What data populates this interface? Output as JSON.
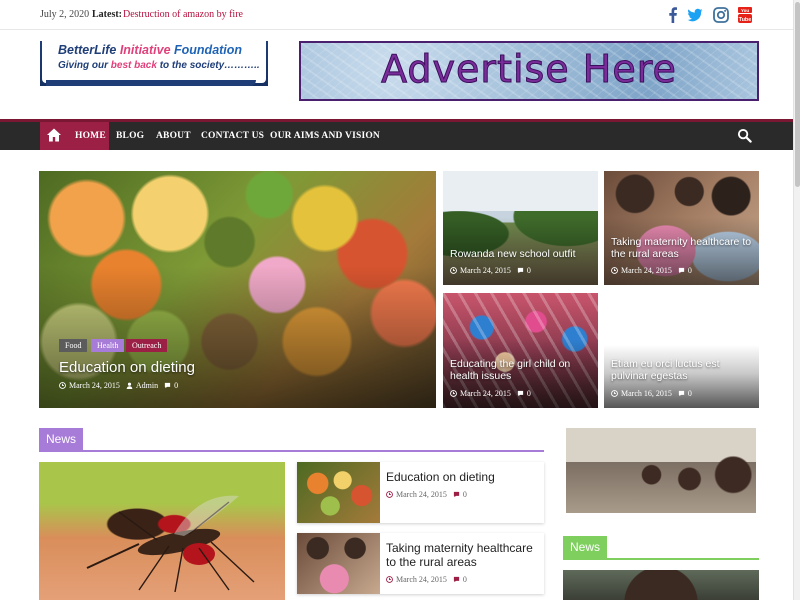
{
  "topbar": {
    "date": "July 2, 2020",
    "latest_label": "Latest:",
    "latest_link": "Destruction of amazon by fire"
  },
  "social": [
    "facebook-icon",
    "twitter-icon",
    "instagram-icon",
    "youtube-icon"
  ],
  "logo": {
    "line1_a": "BetterLife ",
    "line1_b": "Initiative ",
    "line1_c": "Foundation",
    "line2_a": "Giving our ",
    "line2_b": "best back",
    "line2_c": " to the society……….."
  },
  "ad": {
    "text": "Advertise Here"
  },
  "nav": {
    "items": [
      "HOME",
      "BLOG",
      "ABOUT",
      "CONTACT US",
      "OUR AIMS AND VISION"
    ]
  },
  "featured": {
    "tags": [
      "Food",
      "Health",
      "Outreach"
    ],
    "title": "Education on dieting",
    "date": "March 24, 2015",
    "author": "Admin",
    "comments": "0"
  },
  "grid": [
    {
      "title": "Rowanda new school outfit",
      "date": "March 24, 2015",
      "comments": "0"
    },
    {
      "title": "Taking maternity healthcare to the rural areas",
      "date": "March 24, 2015",
      "comments": "0"
    },
    {
      "title": "Educating the girl child on health issues",
      "date": "March 24, 2015",
      "comments": "0"
    },
    {
      "title": "Etiam eu orci luctus est pulvinar egestas",
      "date": "March 16, 2015",
      "comments": "0"
    }
  ],
  "news_section": {
    "label": "News"
  },
  "news_list": [
    {
      "title": "Education on dieting",
      "date": "March 24, 2015",
      "comments": "0"
    },
    {
      "title": "Taking maternity healthcare to the rural areas",
      "date": "March 24, 2015",
      "comments": "0"
    }
  ],
  "sidebar": {
    "news_label": "News"
  },
  "colors": {
    "brand": "#9c2046",
    "nav_bg": "#2a2a2a",
    "news_accent": "#a77bd8",
    "sidebar_accent": "#7fcf5f",
    "latest_link": "#b3123e"
  }
}
